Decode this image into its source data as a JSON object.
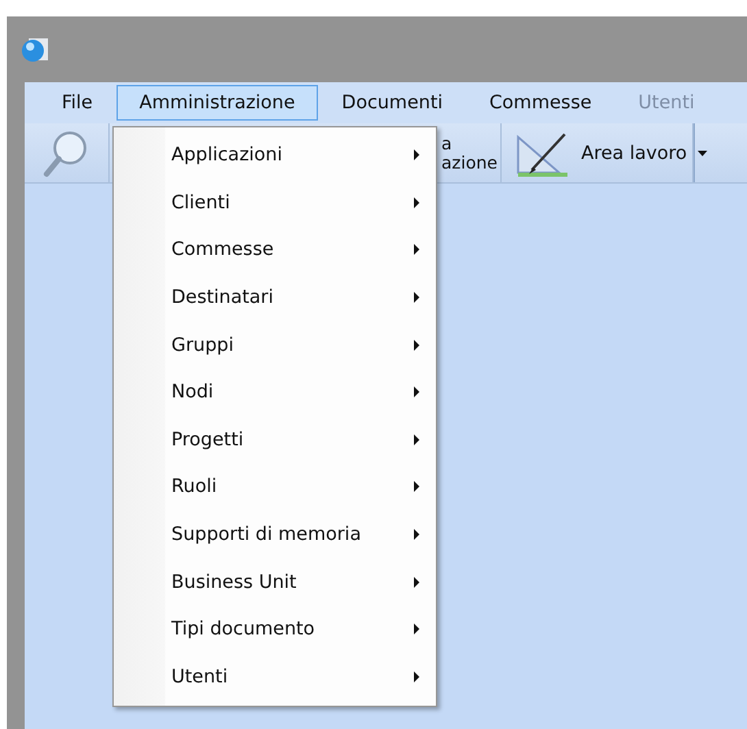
{
  "menubar": [
    {
      "label": "File",
      "selected": false,
      "disabled": false
    },
    {
      "label": "Amministrazione",
      "selected": true,
      "disabled": false
    },
    {
      "label": "Documenti",
      "selected": false,
      "disabled": false
    },
    {
      "label": "Commesse",
      "selected": false,
      "disabled": false
    },
    {
      "label": "Utenti",
      "selected": false,
      "disabled": true
    }
  ],
  "toolbar": [
    {
      "kind": "search"
    },
    {
      "kind": "text",
      "lines": [
        "a",
        "azione"
      ]
    },
    {
      "kind": "workspace",
      "label": "Area lavoro"
    }
  ],
  "dropdown": [
    {
      "label": "Applicazioni",
      "submenu": true
    },
    {
      "label": "Clienti",
      "submenu": true
    },
    {
      "label": "Commesse",
      "submenu": true
    },
    {
      "label": "Destinatari",
      "submenu": true
    },
    {
      "label": "Gruppi",
      "submenu": true
    },
    {
      "label": "Nodi",
      "submenu": true
    },
    {
      "label": "Progetti",
      "submenu": true
    },
    {
      "label": "Ruoli",
      "submenu": true
    },
    {
      "label": "Supporti di memoria",
      "submenu": true
    },
    {
      "label": "Business Unit",
      "submenu": true
    },
    {
      "label": "Tipi documento",
      "submenu": true
    },
    {
      "label": "Utenti",
      "submenu": true
    }
  ]
}
